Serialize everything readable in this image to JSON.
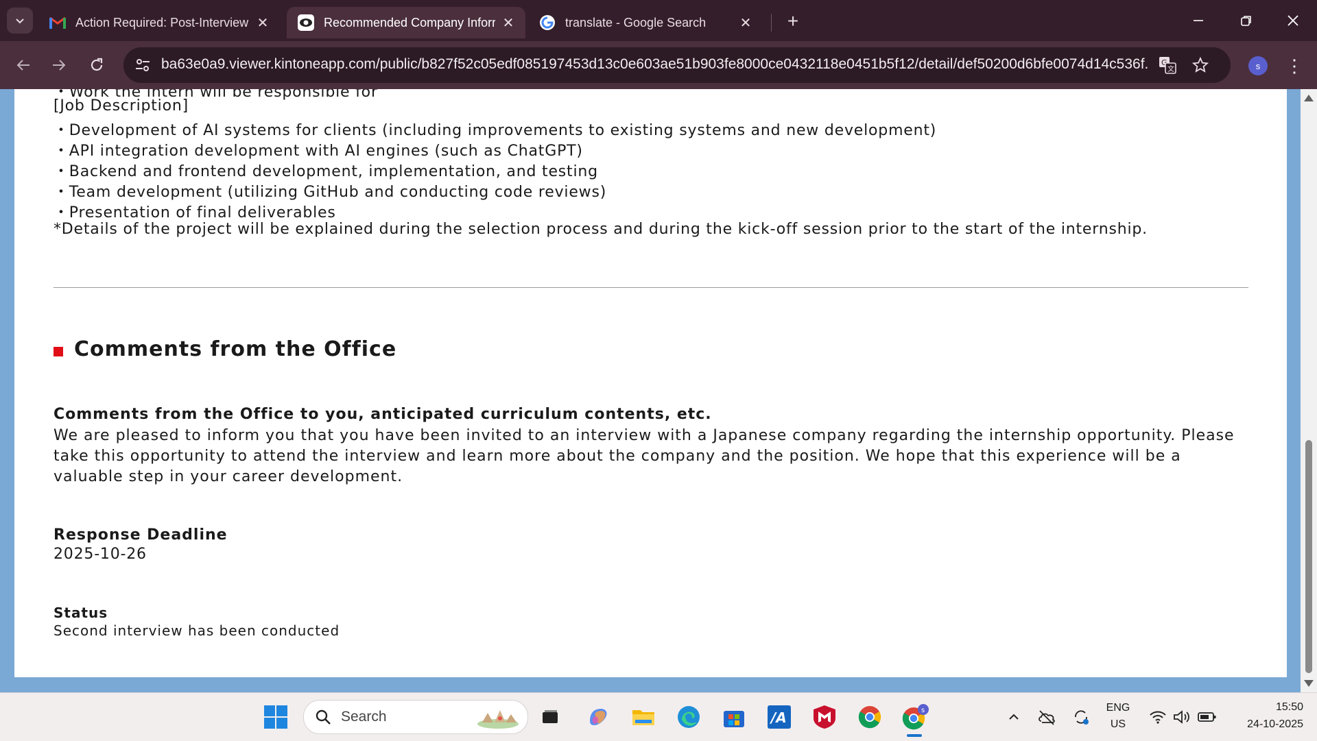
{
  "browser": {
    "tabs": [
      {
        "title": "Action Required: Post-Interview",
        "favicon": "gmail-icon",
        "active": false
      },
      {
        "title": "Recommended Company Inforr",
        "favicon": "eye-icon",
        "active": true
      },
      {
        "title": "translate - Google Search",
        "favicon": "google-icon",
        "active": false
      }
    ],
    "url": "ba63e0a9.viewer.kintoneapp.com/public/b827f52c05edf085197453d13c0e603ae51b903fe8000ce0432118e0451b5f12/detail/def50200d6bfe0074d14c536f...",
    "profile_initial": "s",
    "accent_color": "#351e2b"
  },
  "page": {
    "cut_off_text": "・Work the intern will be responsible for",
    "job_description_heading": "[Job Description]",
    "job_items": [
      "・Development of AI systems for clients (including improvements to existing systems and new development)",
      "・API integration development with AI engines (such as ChatGPT)",
      "・Backend and frontend development, implementation, and testing",
      "・Team development (utilizing GitHub and conducting code reviews)",
      "・Presentation of final deliverables"
    ],
    "details_note": "*Details of the project will be explained during the selection process and during the kick-off session prior to the start of the internship.",
    "section_title": "Comments from the Office",
    "comments_label": "Comments from the Office to you, anticipated curriculum contents, etc.",
    "comments_text": "We are pleased to inform you that you have been invited to an interview with a Japanese company regarding the internship opportunity. Please take this opportunity to attend the interview and learn more about the company and the position. We hope that this experience will be a valuable step in your career development.",
    "deadline_label": "Response Deadline",
    "deadline_value": "2025-10-26",
    "status_label": "Status",
    "status_value": "Second interview has been conducted",
    "section_marker_color": "#e10e17"
  },
  "taskbar": {
    "search_placeholder": "Search",
    "language_line1": "ENG",
    "language_line2": "US",
    "time": "15:50",
    "date": "24-10-2025"
  }
}
